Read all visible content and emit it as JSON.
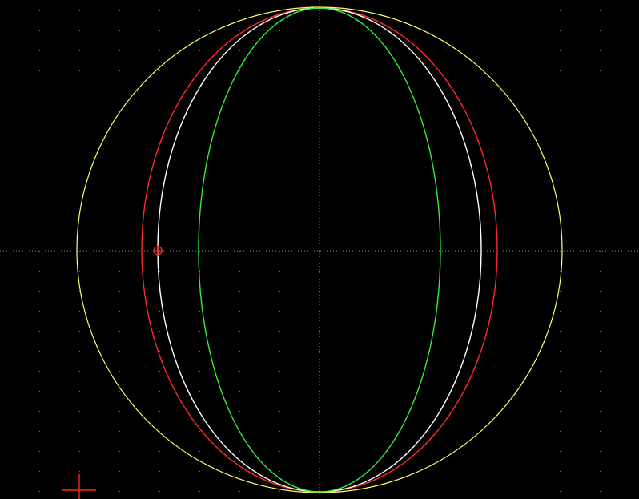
{
  "viewport": {
    "background": "#000000",
    "grid_color": "#6a6a6a",
    "axis_color": "#8a8a8a"
  },
  "shapes": [
    {
      "name": "yellow-circle",
      "color": "#ffff66",
      "kind": "circle"
    },
    {
      "name": "red-curve",
      "color": "#ff2a2a",
      "kind": "ellipse"
    },
    {
      "name": "white-ellipse",
      "color": "#ffffff",
      "kind": "ellipse"
    },
    {
      "name": "green-ellipse",
      "color": "#33ee33",
      "kind": "ellipse"
    }
  ],
  "markers": {
    "point_marker": {
      "color": "#ff3333",
      "icon": "crosshair-point-icon"
    },
    "origin_marker": {
      "color": "#ff2222",
      "icon": "ucs-cross-icon"
    }
  }
}
